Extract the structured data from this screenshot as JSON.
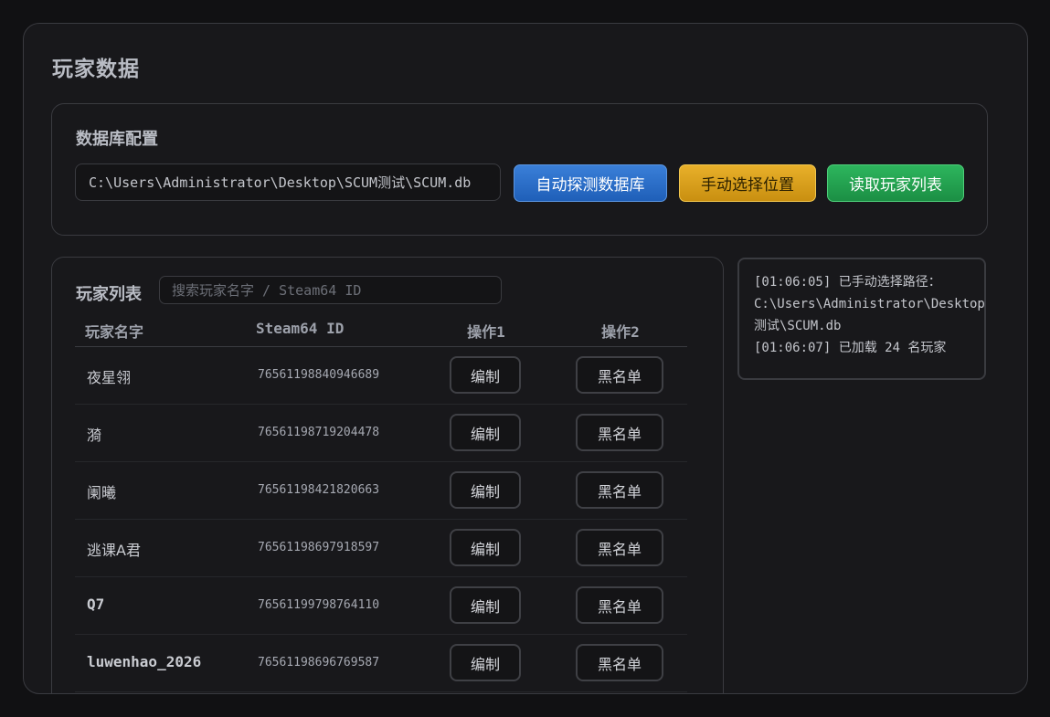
{
  "page": {
    "title": "玩家数据"
  },
  "db": {
    "title": "数据库配置",
    "path_value": "C:\\Users\\Administrator\\Desktop\\SCUM测试\\SCUM.db",
    "auto_detect_label": "自动探测数据库",
    "manual_select_label": "手动选择位置",
    "read_list_label": "读取玩家列表"
  },
  "players": {
    "title": "玩家列表",
    "search_placeholder": "搜索玩家名字 / Steam64 ID",
    "columns": [
      "玩家名字",
      "Steam64 ID",
      "操作1",
      "操作2"
    ],
    "edit_label": "编制",
    "blacklist_label": "黑名单",
    "rows": [
      {
        "name": "夜星翎",
        "steam_id": "76561198840946689"
      },
      {
        "name": "漪",
        "steam_id": "76561198719204478"
      },
      {
        "name": "阑曦",
        "steam_id": "76561198421820663"
      },
      {
        "name": "逃课A君",
        "steam_id": "76561198697918597"
      },
      {
        "name": "Q7",
        "steam_id": "76561199798764110"
      },
      {
        "name": "luwenhao_2026",
        "steam_id": "76561198696769587"
      }
    ]
  },
  "log": {
    "lines": [
      "[01:06:05] 已手动选择路径：",
      "C:\\Users\\Administrator\\Desktop\\SCUM",
      "测试\\SCUM.db",
      "[01:06:07] 已加载 24 名玩家"
    ]
  },
  "colors": {
    "background": "#111113",
    "panel": "#18181b",
    "border": "#3a3b40",
    "primary_blue": "#2a6fc9",
    "warning_yellow": "#e0a81f",
    "success_green": "#24a650"
  }
}
